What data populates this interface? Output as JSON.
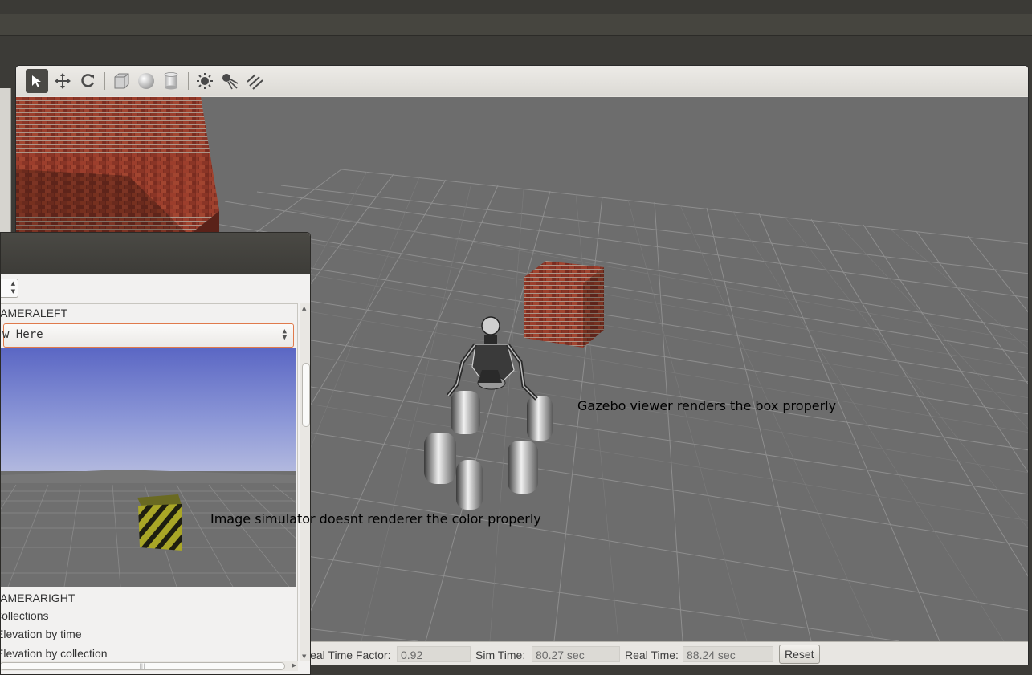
{
  "gazebo": {
    "toolbar": {
      "select_icon": "arrow-cursor-icon",
      "translate_icon": "move-arrows-icon",
      "rotate_icon": "rotate-icon",
      "box_icon": "box-icon",
      "sphere_icon": "sphere-icon",
      "cylinder_icon": "cylinder-icon",
      "pointlight_icon": "sun-icon",
      "spotlight_icon": "spotlight-icon",
      "dirlight_icon": "directional-light-icon"
    },
    "status": {
      "real_time_factor_label": "Real Time Factor:",
      "real_time_factor_value": "0.92",
      "sim_time_label": "Sim Time:",
      "sim_time_value": "80.27 sec",
      "real_time_label": "Real Time:",
      "real_time_value": "88.24 sec",
      "reset_label": "Reset"
    }
  },
  "annotations": {
    "gazebo_note": "Gazebo viewer renders the box properly",
    "image_note": "Image simulator doesnt renderer the color properly"
  },
  "rqt": {
    "camera_left_label": "CAMERALEFT",
    "topic_combo_value": "Here",
    "camera_right_label": "CAMERARIGHT",
    "collections_label": "Collections",
    "elevation_time_label": "Elevation by time",
    "elevation_collection_label": "Elevation by collection"
  },
  "colors": {
    "accent_focus": "#e07a4c",
    "viewport_bg": "#6d6d6d",
    "panel_bg": "#f2f1f0"
  }
}
